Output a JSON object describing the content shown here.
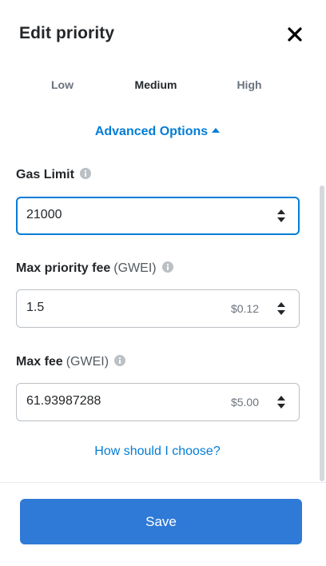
{
  "header": {
    "title": "Edit priority",
    "close_icon": "close-icon"
  },
  "tabs": [
    {
      "label": "Low",
      "selected": false
    },
    {
      "label": "Medium",
      "selected": true
    },
    {
      "label": "High",
      "selected": false
    }
  ],
  "advanced": {
    "label": "Advanced Options",
    "expanded": true
  },
  "fields": {
    "gas_limit": {
      "label": "Gas Limit",
      "unit": "",
      "value": "21000",
      "fiat": ""
    },
    "max_priority_fee": {
      "label": "Max priority fee",
      "unit": "(GWEI)",
      "value": "1.5",
      "fiat": "$0.12"
    },
    "max_fee": {
      "label": "Max fee",
      "unit": "(GWEI)",
      "value": "61.93987288",
      "fiat": "$5.00"
    }
  },
  "help_link": "How should I choose?",
  "save_label": "Save",
  "colors": {
    "accent": "#037dd6",
    "button": "#2f7ad7",
    "text": "#24272a",
    "muted": "#6a737d",
    "border": "#bbc0c5"
  }
}
